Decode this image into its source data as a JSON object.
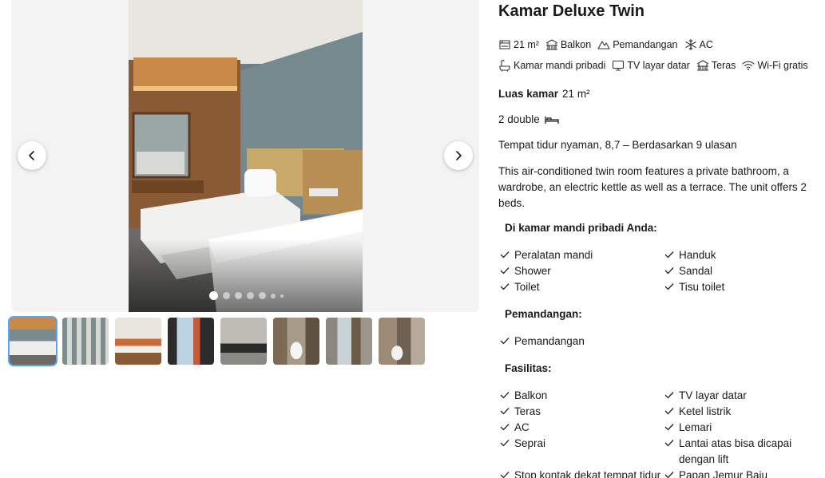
{
  "gallery": {
    "prev_icon": "chevron-left-icon",
    "next_icon": "chevron-right-icon",
    "dots_total": 7,
    "active_index": 0,
    "thumbnails": [
      {
        "name": "thumb-bedroom",
        "active": true
      },
      {
        "name": "thumb-balcony-corridor",
        "active": false
      },
      {
        "name": "thumb-amenities-tray",
        "active": false
      },
      {
        "name": "thumb-window-view",
        "active": false
      },
      {
        "name": "thumb-bathroom-sink",
        "active": false
      },
      {
        "name": "thumb-toilet",
        "active": false
      },
      {
        "name": "thumb-room-door",
        "active": false
      },
      {
        "name": "thumb-shower-toilet",
        "active": false
      }
    ]
  },
  "room": {
    "title": "Kamar Deluxe Twin",
    "facilities_row1": [
      {
        "icon": "room-size-icon",
        "label": "21 m²"
      },
      {
        "icon": "balcony-icon",
        "label": "Balkon"
      },
      {
        "icon": "mountain-view-icon",
        "label": "Pemandangan"
      },
      {
        "icon": "snowflake-ac-icon",
        "label": "AC"
      }
    ],
    "facilities_row2": [
      {
        "icon": "bath-icon",
        "label": "Kamar mandi pribadi"
      },
      {
        "icon": "tv-icon",
        "label": "TV layar datar"
      },
      {
        "icon": "terrace-icon",
        "label": "Teras"
      },
      {
        "icon": "wifi-icon",
        "label": "Wi-Fi gratis"
      }
    ],
    "size_label": "Luas kamar",
    "size_value": "21 m²",
    "beds": "2 double",
    "bed_icon": "bed-icon",
    "rating_text": "Tempat tidur nyaman, 8,7 – Berdasarkan 9 ulasan",
    "description": "This air-conditioned twin room features a private bathroom, a wardrobe, an electric kettle as well as a terrace. The unit offers 2 beds."
  },
  "sections": {
    "bathroom": {
      "heading": "Di kamar mandi pribadi Anda:",
      "items": [
        "Peralatan mandi",
        "Handuk",
        "Shower",
        "Sandal",
        "Toilet",
        "Tisu toilet"
      ]
    },
    "view": {
      "heading": "Pemandangan:",
      "items": [
        "Pemandangan"
      ]
    },
    "facilities": {
      "heading": "Fasilitas:",
      "items": [
        "Balkon",
        "TV layar datar",
        "Teras",
        "Ketel listrik",
        "AC",
        "Lemari",
        "Seprai",
        "Lantai atas bisa dicapai dengan lift",
        "Stop kontak dekat tempat tidur",
        "Papan Jemur Baju"
      ]
    }
  },
  "colors": {
    "text": "#1a1a1a",
    "thumb_active_outline": "#5ea4ee",
    "gallery_bg": "#f3f3f3"
  }
}
